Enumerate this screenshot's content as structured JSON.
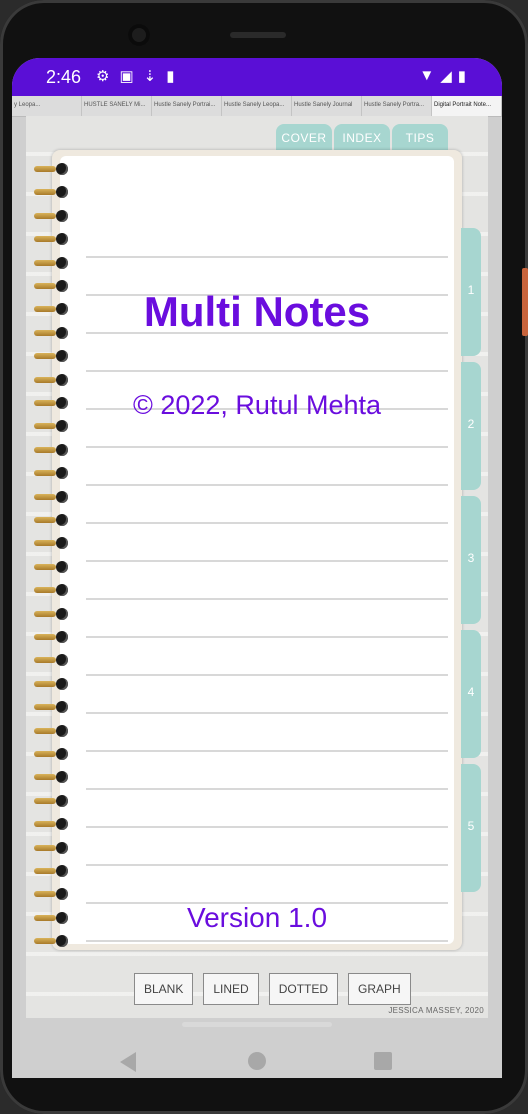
{
  "status_bar": {
    "time": "2:46",
    "left_icons": [
      "gear-icon",
      "font-icon",
      "download-icon",
      "sd-card-icon"
    ],
    "right_icons": [
      "wifi-icon",
      "signal-icon",
      "battery-icon"
    ]
  },
  "tabs": [
    {
      "label": "y Leopa..."
    },
    {
      "label": "HUSTLE SANELY Mi..."
    },
    {
      "label": "Hustle Sanely Portrai..."
    },
    {
      "label": "Hustle Sanely Leopa..."
    },
    {
      "label": "Hustle Sanely Journal"
    },
    {
      "label": "Hustle Sanely Portra..."
    },
    {
      "label": "Digital Portrait Note..."
    }
  ],
  "top_tabs": [
    "COVER",
    "INDEX",
    "TIPS"
  ],
  "side_tabs": [
    "1",
    "2",
    "3",
    "4",
    "5"
  ],
  "notebook": {
    "title": "Multi Notes",
    "copyright": "© 2022, Rutul Mehta",
    "version": "Version 1.0"
  },
  "bottom_buttons": [
    "BLANK",
    "LINED",
    "DOTTED",
    "GRAPH"
  ],
  "credit": "JESSICA MASSEY, 2020",
  "colors": {
    "status_bar": "#5a0fd6",
    "text_accent": "#6a0dde",
    "tab_teal": "#a7d6d0"
  }
}
